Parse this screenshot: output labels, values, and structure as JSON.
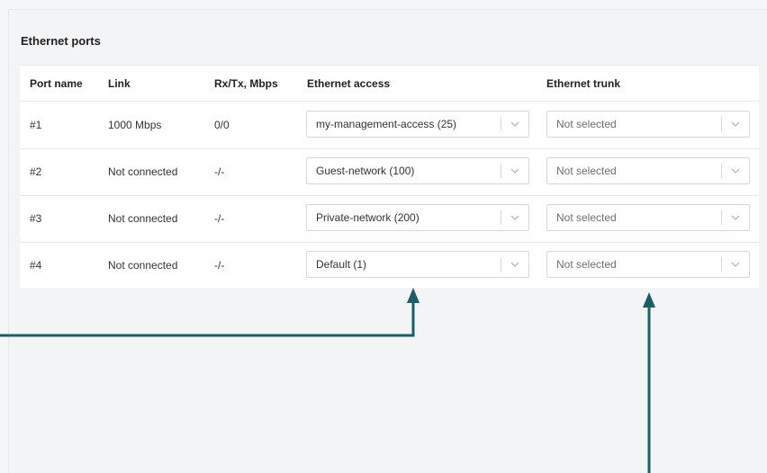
{
  "section_title": "Ethernet ports",
  "columns": {
    "port_name": "Port name",
    "link": "Link",
    "rxtx": "Rx/Tx, Mbps",
    "access": "Ethernet access",
    "trunk": "Ethernet trunk"
  },
  "rows": [
    {
      "port": "#1",
      "link": "1000 Mbps",
      "rxtx": "0/0",
      "access": "my-management-access (25)",
      "trunk": "Not selected"
    },
    {
      "port": "#2",
      "link": "Not connected",
      "rxtx": "-/-",
      "access": "Guest-network (100)",
      "trunk": "Not selected"
    },
    {
      "port": "#3",
      "link": "Not connected",
      "rxtx": "-/-",
      "access": "Private-network (200)",
      "trunk": "Not selected"
    },
    {
      "port": "#4",
      "link": "Not connected",
      "rxtx": "-/-",
      "access": "Default (1)",
      "trunk": "Not selected"
    }
  ],
  "colors": {
    "annotation_arrow": "#1b5e63",
    "border": "#e8e9eb"
  },
  "icons": {
    "dropdown": "chevron-down-icon",
    "callout": "arrow-up-icon"
  }
}
